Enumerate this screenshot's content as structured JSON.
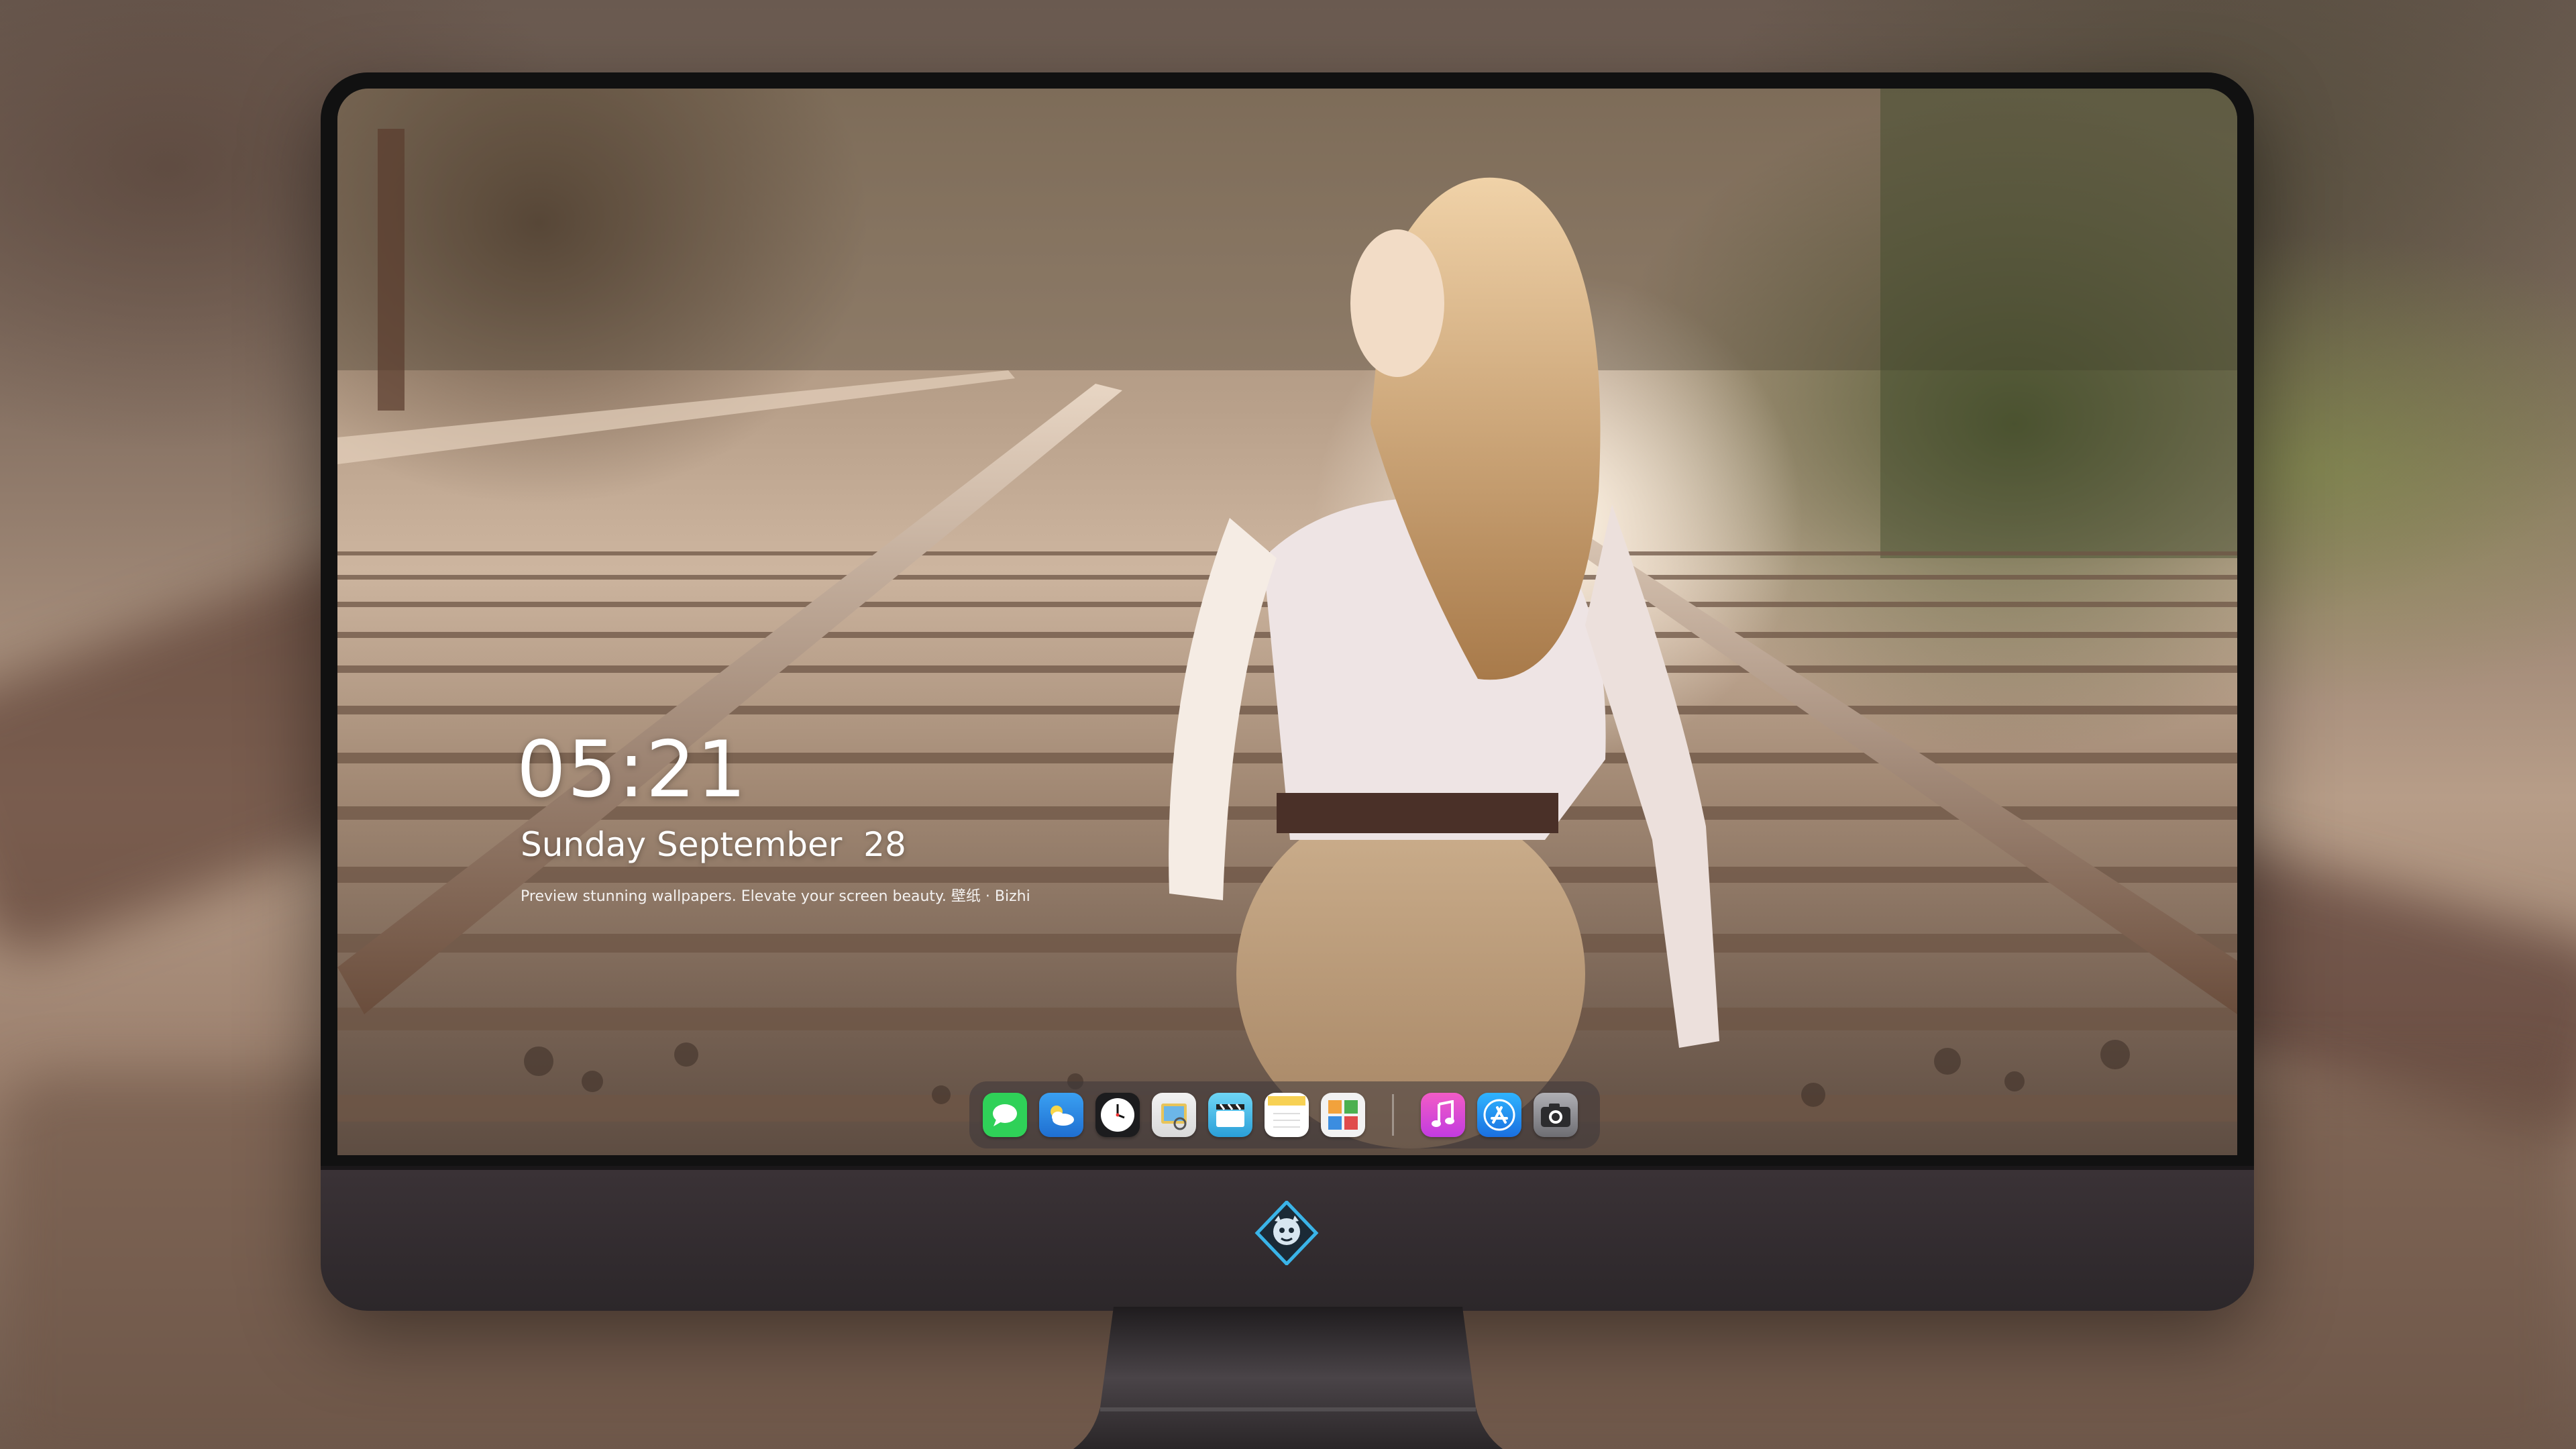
{
  "lockscreen": {
    "time": "05:21",
    "date": "Sunday September  28",
    "subtitle": "Preview stunning wallpapers. Elevate your screen beauty. 壁纸 · Bizhi"
  },
  "dock": {
    "apps": [
      {
        "name": "messages-icon",
        "color": "#2fd158"
      },
      {
        "name": "weather-icon",
        "color": "#3aa0f2"
      },
      {
        "name": "clock-icon",
        "color": "#1c1c1e"
      },
      {
        "name": "preview-icon",
        "color": "#e8c45a"
      },
      {
        "name": "clips-icon",
        "color": "#4fc1e9"
      },
      {
        "name": "notes-icon",
        "color": "#f7d154"
      },
      {
        "name": "photos-icon",
        "color": "#f2f2f2"
      },
      {
        "name": "music-icon",
        "color": "#e24bd8"
      },
      {
        "name": "app-store-icon",
        "color": "#1a8cf0"
      },
      {
        "name": "camera-icon",
        "color": "#8e8e93"
      }
    ]
  },
  "colors": {
    "monitor_body": "#2f2a2e",
    "logo_accent": "#3ab4e8"
  }
}
